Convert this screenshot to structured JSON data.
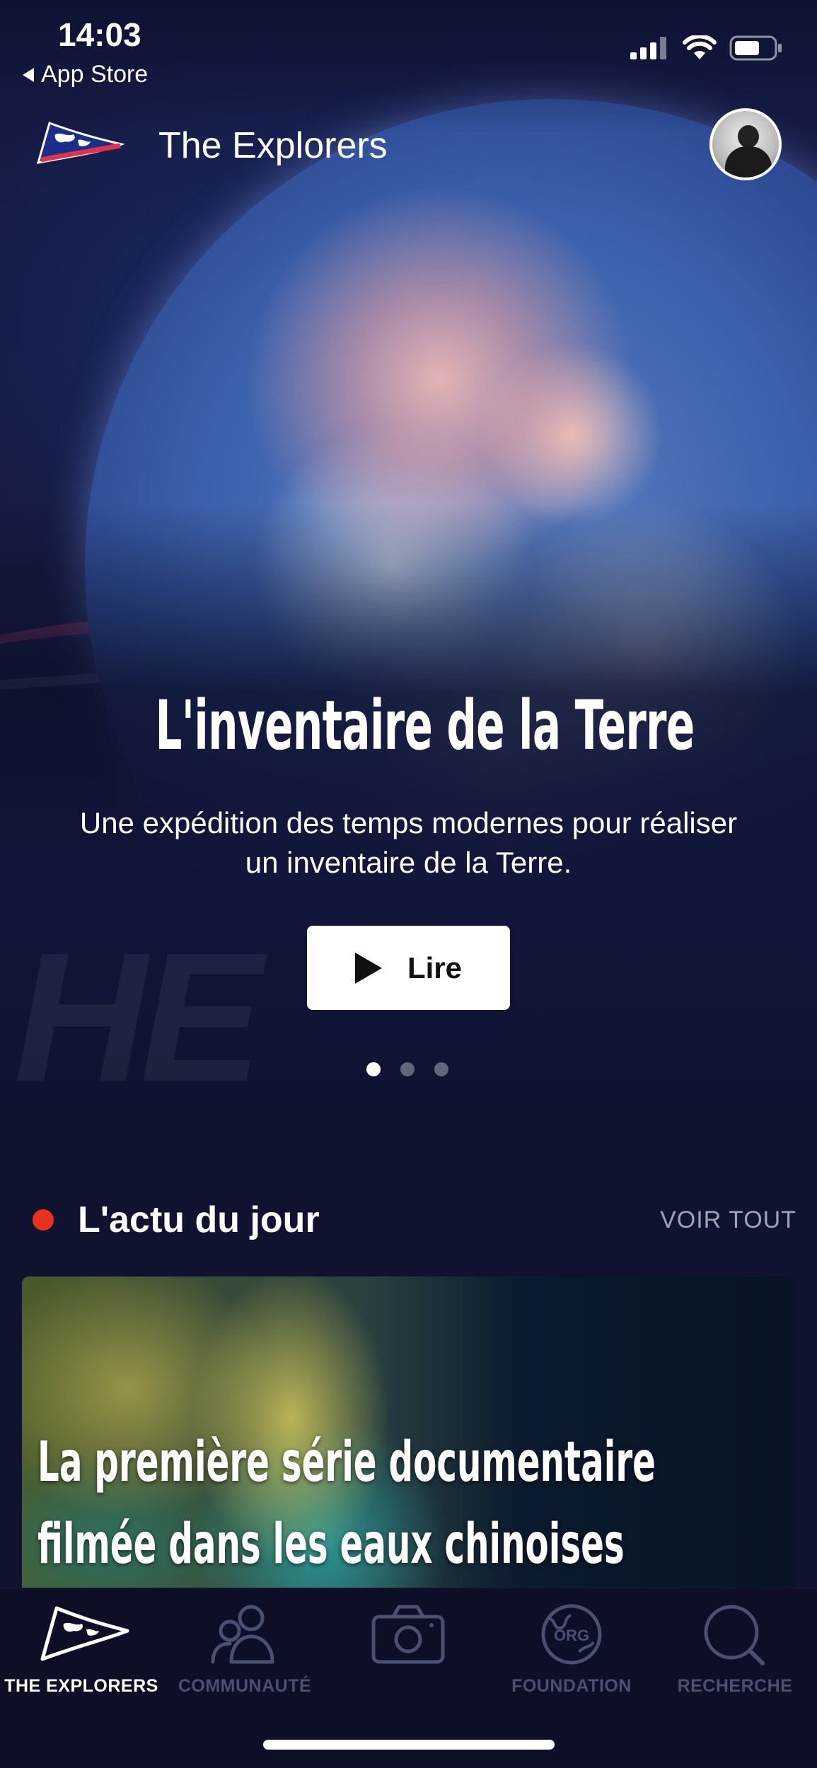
{
  "status_bar": {
    "time": "14:03",
    "back_label": "App Store"
  },
  "header": {
    "title": "The Explorers",
    "logo_icon": "explorers-flag-logo",
    "avatar_icon": "user-avatar"
  },
  "hero": {
    "title": "L'inventaire de la Terre",
    "subtitle": "Une expédition des temps modernes pour réaliser un inventaire de la Terre.",
    "play_label": "Lire",
    "carousel": {
      "total": 3,
      "active_index": 0
    }
  },
  "news_section": {
    "title": "L'actu du jour",
    "see_all": "VOIR TOUT",
    "card_title": "La première série documentaire filmée dans les eaux chinoises"
  },
  "tab_bar": {
    "tabs": [
      {
        "label": "THE EXPLORERS",
        "icon": "explorers-flag-icon",
        "active": true
      },
      {
        "label": "COMMUNAUTÉ",
        "icon": "community-icon",
        "active": false
      },
      {
        "label": "",
        "icon": "camera-icon",
        "active": false
      },
      {
        "label": "FOUNDATION",
        "icon": "foundation-globe-icon",
        "active": false
      },
      {
        "label": "RECHERCHE",
        "icon": "search-icon",
        "active": false
      }
    ]
  },
  "colors": {
    "background": "#0f1330",
    "live_dot": "#e8321e",
    "inactive_tab": "#4b5070",
    "see_all": "#9fa3b6"
  }
}
